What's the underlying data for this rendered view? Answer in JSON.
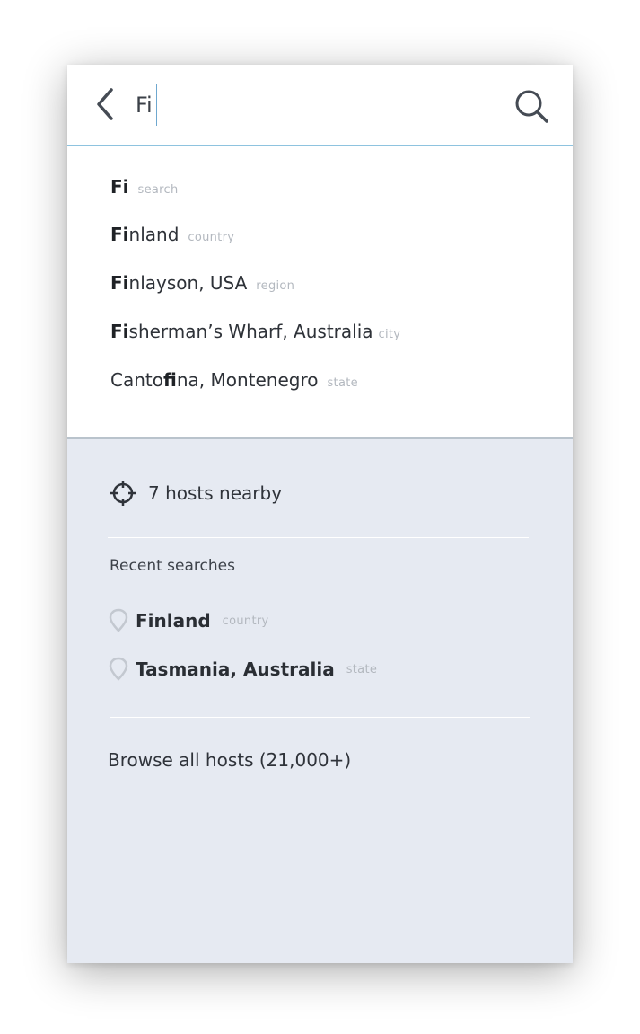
{
  "search": {
    "query": "Fi"
  },
  "suggestions": [
    {
      "bold": "Fi",
      "rest": "",
      "type": "search"
    },
    {
      "bold": "Fi",
      "rest": "nland",
      "type": "country"
    },
    {
      "bold": "Fi",
      "rest": "nlayson, USA",
      "type": "region"
    },
    {
      "bold": "Fi",
      "rest": "sherman’s Wharf, Australia",
      "type": "city"
    },
    {
      "pre": "Canto",
      "bold": "fi",
      "rest": "na, Montenegro",
      "type": "state"
    }
  ],
  "nearby": {
    "label": "7 hosts nearby"
  },
  "recent": {
    "title": "Recent searches",
    "items": [
      {
        "name": "Finland",
        "type": "country"
      },
      {
        "name": "Tasmania, Australia",
        "type": "state"
      }
    ]
  },
  "browse": {
    "label": "Browse all hosts (21,000+)"
  },
  "colors": {
    "accent": "#8ec3df",
    "panel": "#e6eaf2",
    "tag": "#b3b8bf"
  }
}
